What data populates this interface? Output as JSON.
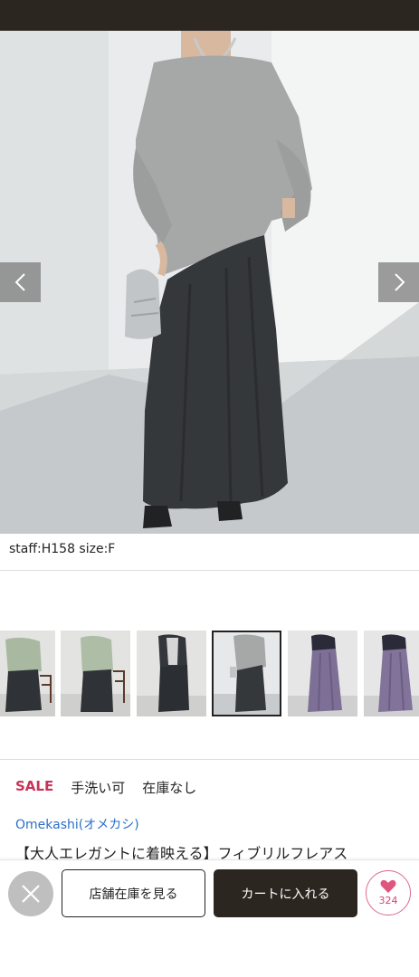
{
  "product": {
    "staff_caption": "staff:H158 size:F",
    "tags": {
      "sale": "SALE",
      "washable": "手洗い可",
      "stock": "在庫なし"
    },
    "brand": "Omekashi(オメカシ)",
    "title": "【大人エレガントに着映える】フィブリルフレアス"
  },
  "actions": {
    "store_stock_label": "店舗在庫を見る",
    "add_to_cart_label": "カートに入れる",
    "favorite_count": "324"
  },
  "gallery": {
    "active_index": 3,
    "thumbnail_count": 6
  },
  "colors": {
    "sale": "#c9335a",
    "brand_link": "#2b6fc9",
    "dark": "#2b2620",
    "favorite": "#e06a88"
  },
  "icons": {
    "prev": "chevron-left-icon",
    "next": "chevron-right-icon",
    "close": "close-icon",
    "favorite": "heart-icon"
  }
}
